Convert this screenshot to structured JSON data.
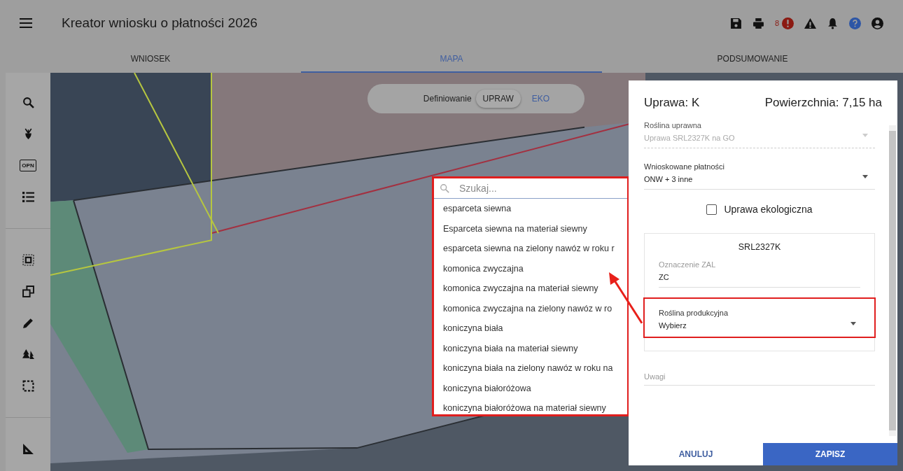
{
  "app_bar": {
    "title": "Kreator wniosku o płatności 2026",
    "error_count": "8"
  },
  "tabs": [
    {
      "label": "WNIOSEK",
      "selected": false
    },
    {
      "label": "MAPA",
      "selected": true
    },
    {
      "label": "PODSUMOWANIE",
      "selected": false
    }
  ],
  "sidebar": {
    "opn_label": "OPN"
  },
  "mode_switch": {
    "label": "Definiowanie",
    "options": [
      {
        "label": "UPRAW",
        "selected": true
      },
      {
        "label": "EKO",
        "selected": false
      }
    ]
  },
  "crop_picker": {
    "placeholder": "Szukaj...",
    "options": [
      "esparceta siewna",
      "Esparceta siewna na materiał siewny",
      "esparceta siewna na zielony nawóz w roku r",
      "komonica zwyczajna",
      "komonica zwyczajna na materiał siewny",
      "komonica zwyczajna na zielony nawóz w ro",
      "koniczyna biała",
      "koniczyna biała na materiał siewny",
      "koniczyna biała na zielony nawóz w roku na",
      "koniczyna białoróżowa",
      "koniczyna białoróżowa na materiał siewny"
    ]
  },
  "panel": {
    "title": "Uprawa: K",
    "area": "Powierzchnia: 7,15 ha",
    "fields": [
      {
        "label": "Roślina uprawna",
        "value": "Uprawa SRL2327K na GO",
        "disabled": true
      },
      {
        "label": "Wnioskowane płatności",
        "value": "ONW + 3 inne",
        "disabled": false
      }
    ],
    "eco_checkbox": {
      "label": "Uprawa ekologiczna",
      "checked": false
    },
    "card": {
      "title": "SRL2327K",
      "zal_label": "Oznaczenie ZAL",
      "zal_value": "ZC",
      "production_label": "Roślina produkcyjna",
      "production_value": "Wybierz"
    },
    "notes": {
      "placeholder": "Uwagi"
    },
    "buttons": {
      "cancel": "ANULUJ",
      "save": "ZAPISZ"
    }
  }
}
